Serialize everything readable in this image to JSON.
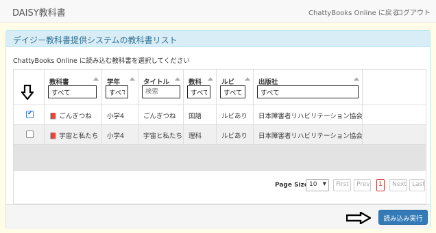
{
  "navbar": {
    "brand": "DAISY教科書",
    "chatty_link": "ChattyBooks Online に戻る",
    "logout_link": "ログアウト"
  },
  "panel": {
    "heading": "デイジー教科書提供システムの教科書リスト",
    "instruction": "ChattyBooks Online に読み込む教科書を選択してください"
  },
  "table": {
    "columns": [
      {
        "label": "教科書",
        "filter_value": "すべて",
        "filter_placeholder": ""
      },
      {
        "label": "学年",
        "filter_value": "すべて",
        "filter_placeholder": ""
      },
      {
        "label": "タイトル",
        "filter_value": "",
        "filter_placeholder": "検索"
      },
      {
        "label": "教科",
        "filter_value": "すべて",
        "filter_placeholder": ""
      },
      {
        "label": "ルビ",
        "filter_value": "すべて",
        "filter_placeholder": ""
      },
      {
        "label": "出版社",
        "filter_value": "すべて",
        "filter_placeholder": ""
      }
    ],
    "rows": [
      {
        "checked": true,
        "textbook": "ごんぎつね",
        "grade": "小学4",
        "title": "ごんぎつね",
        "subject": "国語",
        "ruby": "ルビあり",
        "publisher": "日本障害者リハビリテーション協会"
      },
      {
        "checked": false,
        "textbook": "宇宙と私たち",
        "grade": "小学4",
        "title": "宇宙と私たち",
        "subject": "理科",
        "ruby": "ルビあり",
        "publisher": "日本障害者リハビリテーション協会"
      }
    ]
  },
  "pager": {
    "page_size_label": "Page Size",
    "page_size_value": "10",
    "first": "First",
    "prev": "Prev",
    "current_page": "1",
    "next": "Next",
    "last": "Last"
  },
  "footer": {
    "import_button": "読み込み実行"
  },
  "icons": {
    "row_icon": "book-icon",
    "annotation_arrows": [
      "arrow-down-icon",
      "arrow-right-icon"
    ]
  },
  "colors": {
    "primary": "#337ab7",
    "panel_heading_bg": "#d9edf7",
    "panel_heading_text": "#31708f",
    "current_page": "#c9302c",
    "page_bg": "#fffde8"
  }
}
